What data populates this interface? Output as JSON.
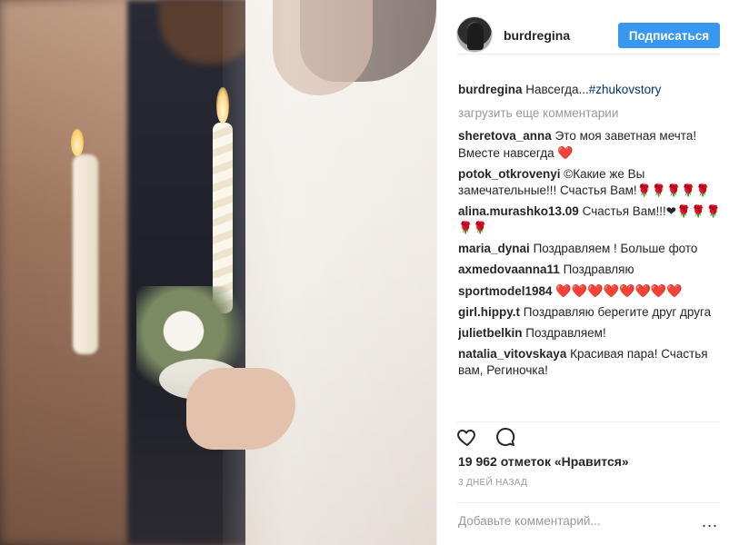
{
  "post": {
    "photo_alt": "Wedding ceremony photo"
  },
  "header": {
    "username": "burdregina",
    "follow_label": "Подписаться"
  },
  "caption": {
    "user": "burdregina",
    "text": "Навсегда...",
    "hashtag": "#zhukovstory"
  },
  "load_more_label": "загрузить еще комментарии",
  "comments": [
    {
      "user": "sheretova_anna",
      "text": "Это моя заветная мечта! Вместе навсегда",
      "emoji": "❤️"
    },
    {
      "user": "potok_otkrovenyi",
      "text": "©Какие же Вы замечательные!!! Счастья Вам!",
      "emoji": "🌹🌹🌹🌹🌹"
    },
    {
      "user": "alina.murashko13.09",
      "text": "Счастья Вам!!!❤",
      "emoji": "🌹🌹🌹🌹🌹"
    },
    {
      "user": "maria_dynai",
      "text": "Поздравляем ! Больше фото",
      "emoji": ""
    },
    {
      "user": "axmedovaanna11",
      "text": "Поздравляю",
      "emoji": ""
    },
    {
      "user": "sportmodel1984",
      "text": "",
      "emoji": "❤️❤️❤️❤️❤️❤️❤️❤️"
    },
    {
      "user": "girl.hippy.t",
      "text": "Поздравляю берегите друг друга",
      "emoji": ""
    },
    {
      "user": "julietbelkin",
      "text": "Поздравляем!",
      "emoji": ""
    },
    {
      "user": "natalia_vitovskaya",
      "text": "Красивая пара! Счастья вам, Региночка!",
      "emoji": ""
    }
  ],
  "likes_text": "19 962 отметок «Нравится»",
  "time_text": "3 ДНЕЙ НАЗАД",
  "add_comment": {
    "placeholder": "Добавьте комментарий...",
    "more_label": "..."
  },
  "colors": {
    "follow_button": "#3897f0",
    "hashtag": "#003569",
    "secondary_text": "#999999"
  },
  "icons": {
    "like": "heart-outline-icon",
    "comment": "speech-bubble-icon",
    "more": "more-options-icon"
  }
}
